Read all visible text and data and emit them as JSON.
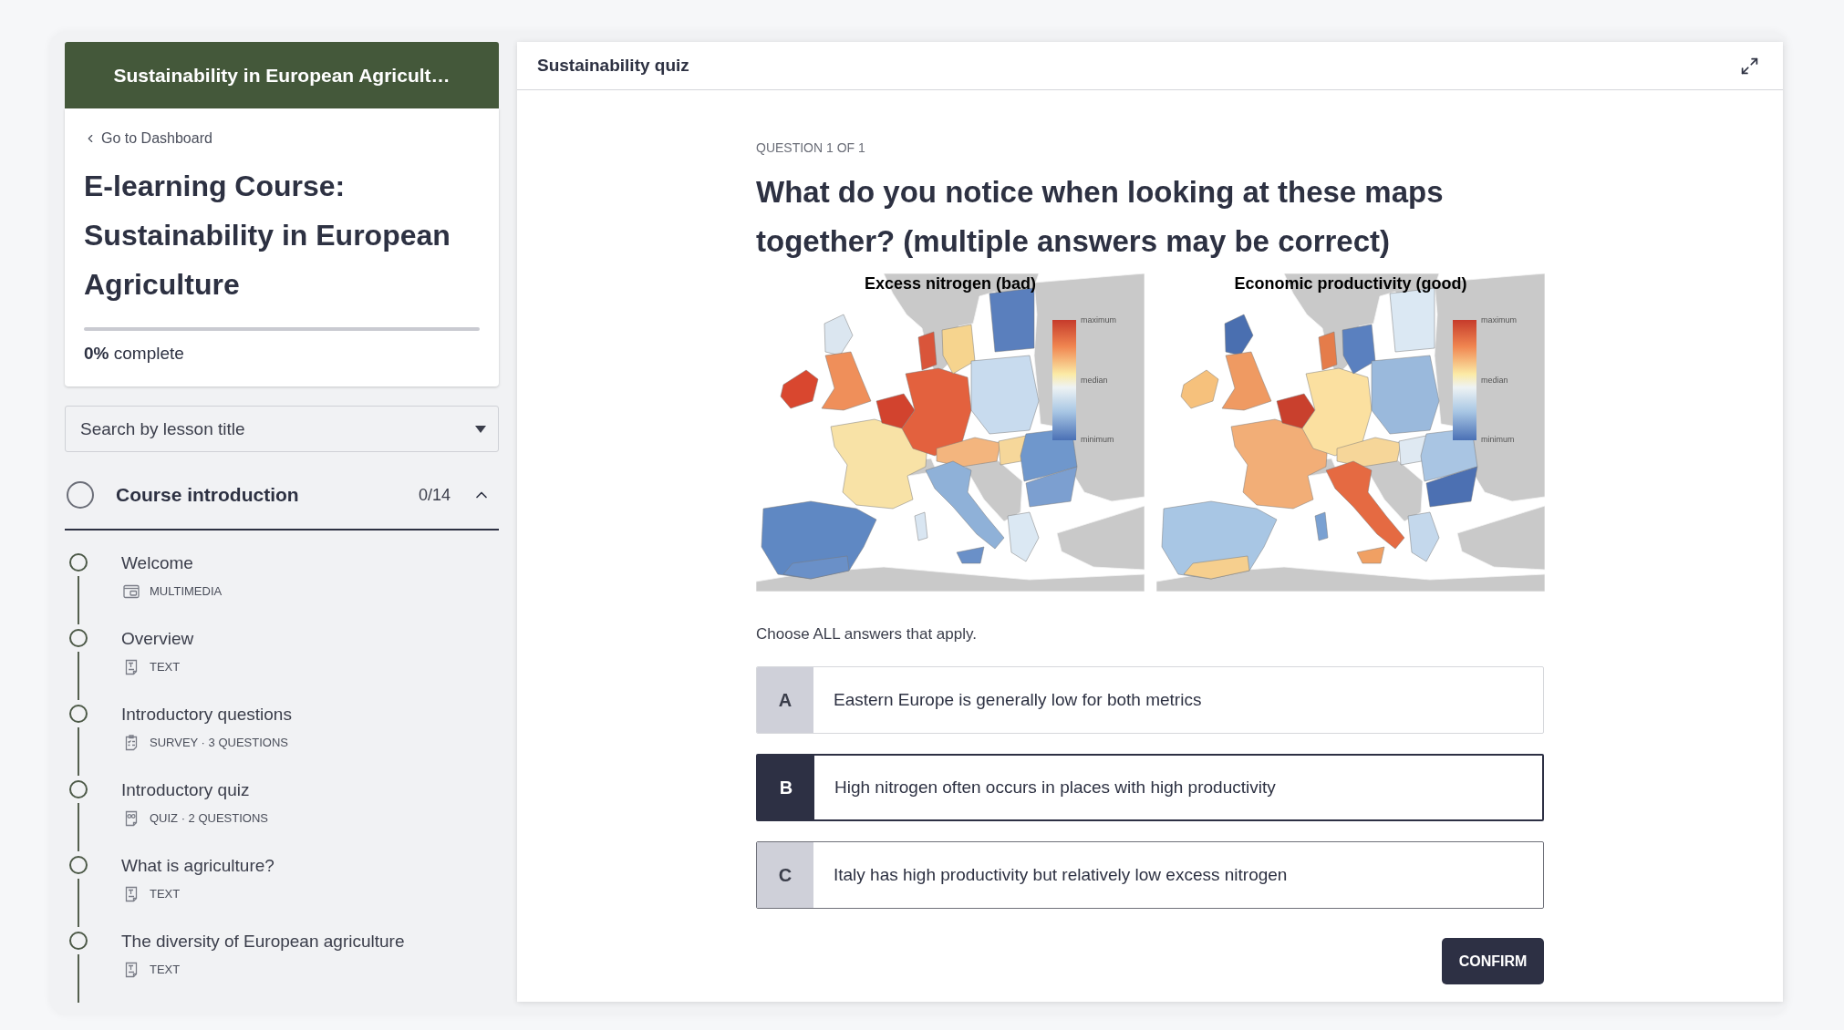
{
  "sidebar": {
    "header_title": "Sustainability in European Agricult…",
    "back_link": "Go to Dashboard",
    "course_title": "E-learning Course: Sustainability in European Agriculture",
    "progress": {
      "level": 0,
      "label": "**0%** complete"
    },
    "search": {
      "placeholder": "Search by lesson title"
    },
    "sections": [
      {
        "title": "Course introduction",
        "count": "0/14",
        "expanded": true,
        "completed": false,
        "lessons": [
          {
            "title": "Welcome",
            "kind": "multimedia",
            "meta": "MULTIMEDIA",
            "completed": false
          },
          {
            "title": "Overview",
            "kind": "text",
            "meta": "TEXT",
            "completed": false
          },
          {
            "title": "Introductory questions",
            "kind": "survey",
            "meta": "SURVEY · 3 QUESTIONS",
            "completed": false
          },
          {
            "title": "Introductory quiz",
            "kind": "quiz",
            "meta": "QUIZ · 2 QUESTIONS",
            "completed": false
          },
          {
            "title": "What is agriculture?",
            "kind": "text",
            "meta": "TEXT",
            "completed": false
          },
          {
            "title": "The diversity of European agriculture",
            "kind": "text",
            "meta": "TEXT",
            "completed": false
          }
        ]
      }
    ]
  },
  "quiz": {
    "title": "Sustainability quiz",
    "counter": "QUESTION 1 OF 1",
    "question": "What do you notice when looking at these maps together? (multiple answers may be correct)",
    "maps": [
      {
        "kind": "excess_nitrogen",
        "title": "Excess nitrogen (bad)",
        "legend": [
          "maximum",
          "median",
          "minimum"
        ]
      },
      {
        "kind": "economic_productivity",
        "title": "Economic productivity (good)",
        "legend": [
          "maximum",
          "median",
          "minimum"
        ]
      }
    ],
    "instruction": "Choose ALL answers that apply.",
    "options": [
      {
        "letter": "A",
        "text": "Eastern Europe is generally low for both metrics",
        "selected": false,
        "hovered": false
      },
      {
        "letter": "B",
        "text": "High nitrogen often occurs in places with high productivity",
        "selected": true,
        "hovered": false
      },
      {
        "letter": "C",
        "text": "Italy has high productivity but relatively low excess nitrogen",
        "selected": false,
        "hovered": true
      }
    ],
    "confirm_button": "CONFIRM"
  }
}
